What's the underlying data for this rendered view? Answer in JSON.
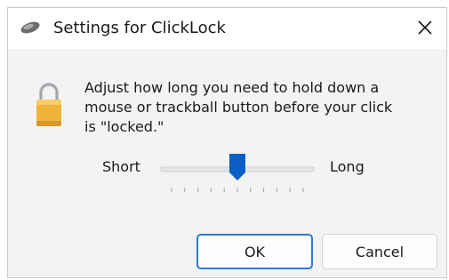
{
  "window": {
    "title": "Settings for ClickLock",
    "title_icon": "mouse-icon",
    "close_glyph": "✕"
  },
  "content": {
    "icon": "padlock-icon",
    "message_lines": [
      "Adjust how long you need to hold down a",
      "mouse or trackball button before your click",
      "is \"locked.\""
    ]
  },
  "slider": {
    "min_label": "Short",
    "max_label": "Long",
    "value_fraction": 0.5,
    "tick_count": 11
  },
  "buttons": {
    "ok_label": "OK",
    "cancel_label": "Cancel"
  },
  "colors": {
    "accent": "#0a5fc4",
    "focus_border": "#2b7bd6",
    "lock_gold": "#f0b43a"
  }
}
